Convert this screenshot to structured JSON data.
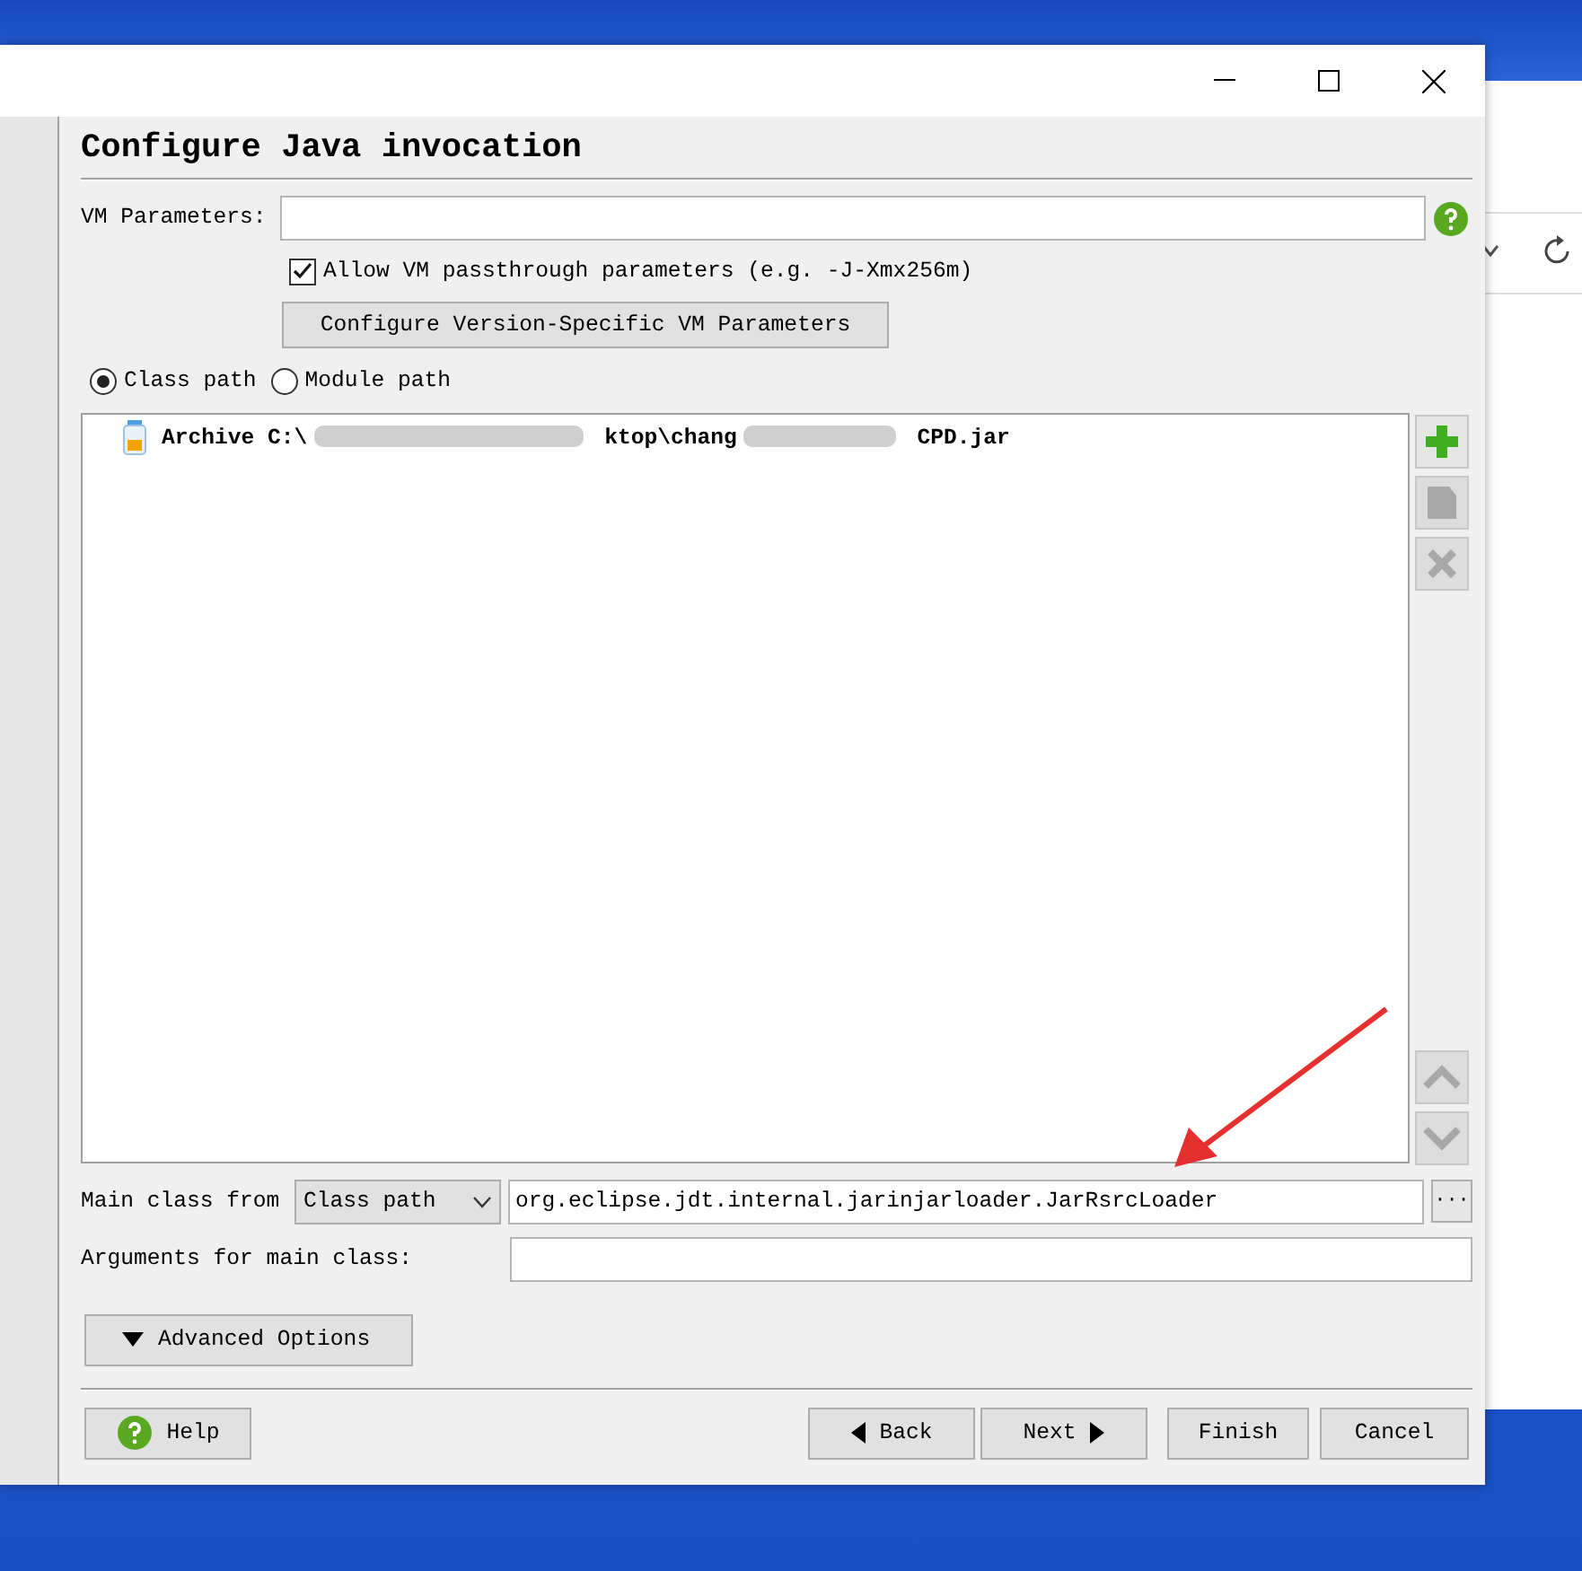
{
  "page_title": "Configure Java invocation",
  "vm_parameters": {
    "label": "VM Parameters:"
  },
  "passthrough": {
    "label": "Allow VM passthrough parameters (e.g. -J-Xmx256m)",
    "checked": true
  },
  "version_button": "Configure Version-Specific VM Parameters",
  "path_modes": [
    {
      "label": "Class path",
      "selected": true
    },
    {
      "label": "Module path",
      "selected": false
    }
  ],
  "entries": [
    {
      "label": "Archive",
      "path_parts": [
        "C:\\",
        "ktop\\chang",
        "CPD.jar"
      ]
    }
  ],
  "side_buttons": [
    {
      "kind": "add",
      "disabled": false
    },
    {
      "kind": "edit",
      "disabled": true
    },
    {
      "kind": "remove",
      "disabled": true
    },
    {
      "kind": "up",
      "disabled": true
    },
    {
      "kind": "down",
      "disabled": true
    }
  ],
  "main_class": {
    "label": "Main class from",
    "source": "Class path",
    "value": "org.eclipse.jdt.internal.jarinjarloader.JarRsrcLoader",
    "browse": "···"
  },
  "arguments": {
    "label": "Arguments for main class:"
  },
  "advanced": {
    "label": "Advanced Options",
    "expanded": false
  },
  "buttons": [
    {
      "kind": "help",
      "label": "Help"
    },
    {
      "kind": "back",
      "label": "Back"
    },
    {
      "kind": "next",
      "label": "Next"
    },
    {
      "kind": "finish",
      "label": "Finish"
    },
    {
      "kind": "cancel",
      "label": "Cancel"
    }
  ]
}
